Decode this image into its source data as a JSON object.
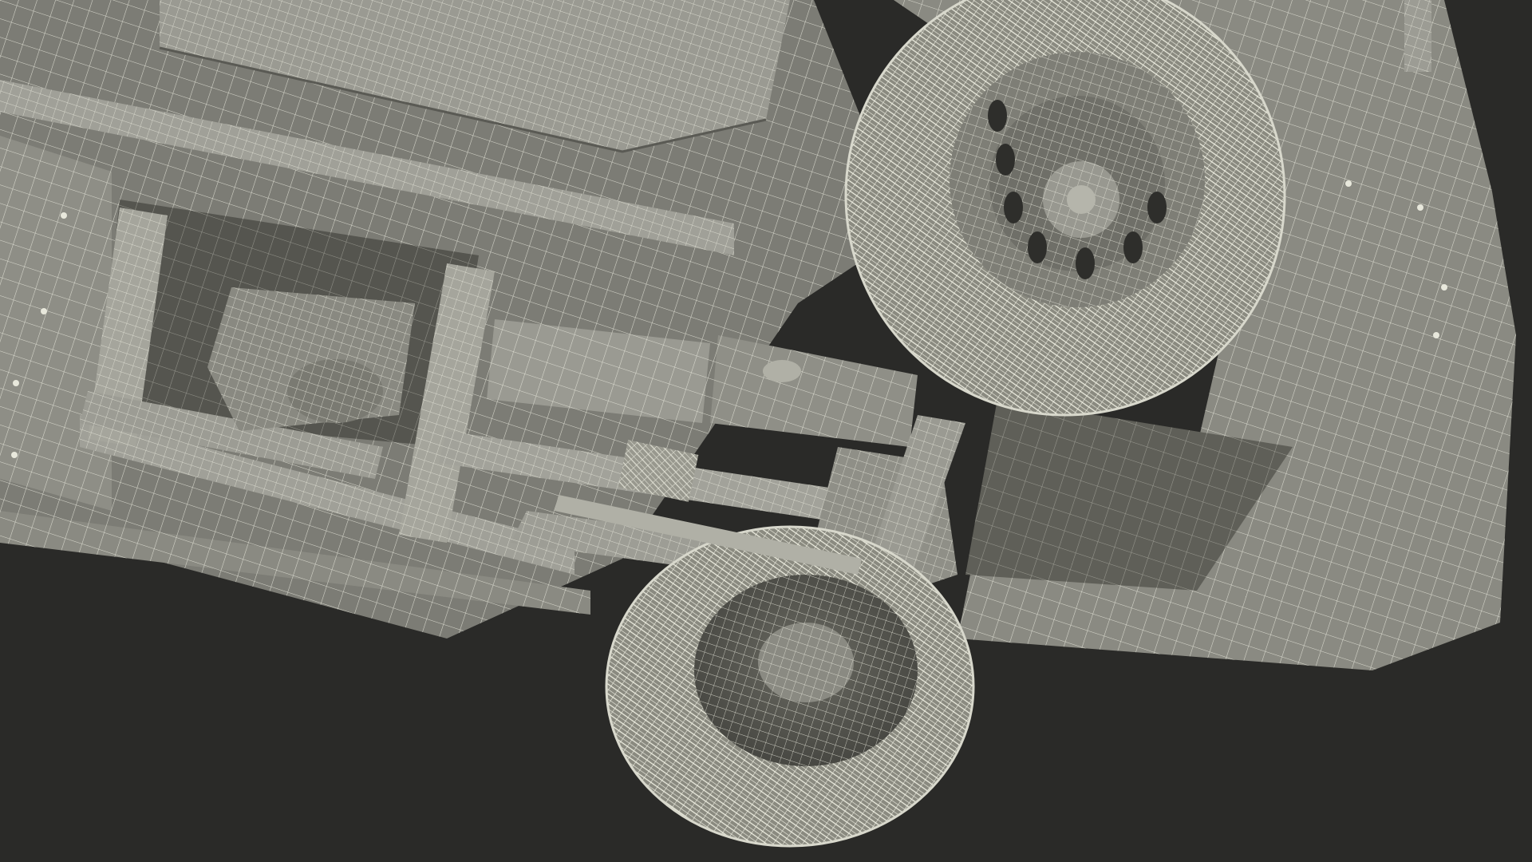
{
  "scene": {
    "subject": "truck-undercarriage-wireframe",
    "colors": {
      "background": "#2a2a28",
      "body": "#8c8c84",
      "body_light": "#a3a39a",
      "body_dark": "#5e5e58",
      "shadow": "#4a4a45",
      "wire": "#e8e8dc",
      "tire": "#9a9a90"
    }
  }
}
